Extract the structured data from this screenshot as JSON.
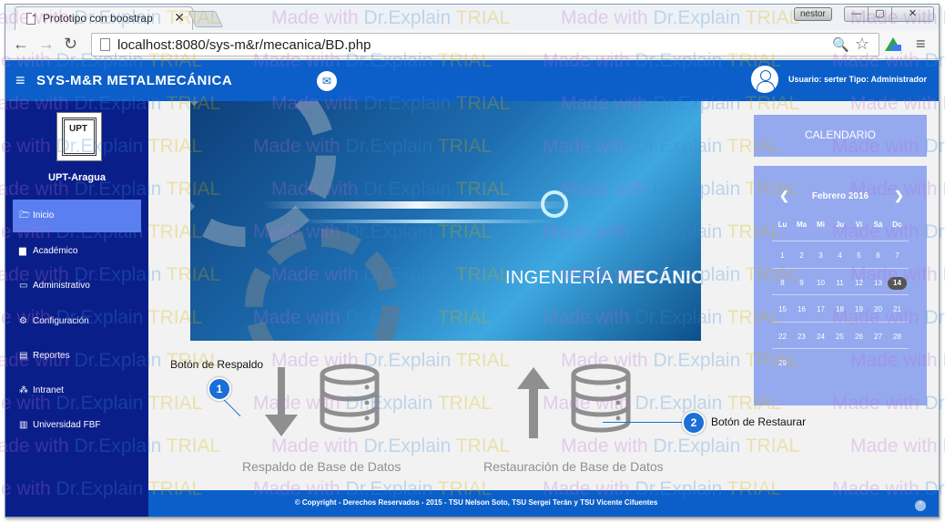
{
  "browser": {
    "tab_title": "Prototipo con boostrap",
    "tab_close": "✕",
    "profile_label": "nestor",
    "url": "localhost:8080/sys-m&r/mecanica/BD.php",
    "window_buttons": {
      "min": "—",
      "max": "▢",
      "close": "✕"
    },
    "back": "←",
    "forward": "→",
    "reload": "↻",
    "zoom_icon": "🔍",
    "star_icon": "☆",
    "menu_icon": "≡"
  },
  "header": {
    "menu_icon": "≡",
    "brand": "SYS-M&R   METALMECÁNICA",
    "mail_icon": "✉",
    "user_text": "Usuario: serter   Tipo: Administrador"
  },
  "sidebar": {
    "logo_text": "UPT",
    "org_name": "UPT-Aragua",
    "items": [
      {
        "icon": "🗁",
        "label": "Inicio",
        "active": true
      },
      {
        "icon": "▆",
        "label": "Académico"
      },
      {
        "icon": "▭",
        "label": "Administrativo"
      },
      {
        "icon": "⚙",
        "label": "Configuración"
      },
      {
        "icon": "▤",
        "label": "Reportes"
      },
      {
        "icon": "⁂",
        "label": "Intranet"
      },
      {
        "icon": "▥",
        "label": "Universidad FBF"
      }
    ]
  },
  "main": {
    "banner_title_light": "INGENIERÍA ",
    "banner_title_bold": "MECÁNICA",
    "backup_caption": "Respaldo de Base de Datos",
    "restore_caption": "Restauración de Base de Datos"
  },
  "calendar": {
    "header": "CALENDARIO",
    "month": "Febrero 2016",
    "prev": "❮",
    "next": "❯",
    "weekdays": [
      "Lu",
      "Ma",
      "Mi",
      "Ju",
      "Vi",
      "Sá",
      "Do"
    ],
    "weeks": [
      [
        "1",
        "2",
        "3",
        "4",
        "5",
        "6",
        "7"
      ],
      [
        "8",
        "9",
        "10",
        "11",
        "12",
        "13",
        "14"
      ],
      [
        "15",
        "16",
        "17",
        "18",
        "19",
        "20",
        "21"
      ],
      [
        "22",
        "23",
        "24",
        "25",
        "26",
        "27",
        "28"
      ],
      [
        "29",
        "",
        "",
        "",
        "",
        "",
        ""
      ]
    ],
    "today": "14"
  },
  "footer": {
    "copyright": "© Copyright - Derechos Reservados - 2015 - TSU Nelson Soto, TSU Sergei Terán y TSU Vicente Cifuentes",
    "up_icon": "^"
  },
  "callouts": [
    {
      "number": "1",
      "label": "Botón de Respaldo"
    },
    {
      "number": "2",
      "label": "Botón de Restaurar"
    }
  ],
  "watermark": {
    "part1": "Made with ",
    "part2": "Dr.Explain ",
    "part3": "TRIAL"
  }
}
